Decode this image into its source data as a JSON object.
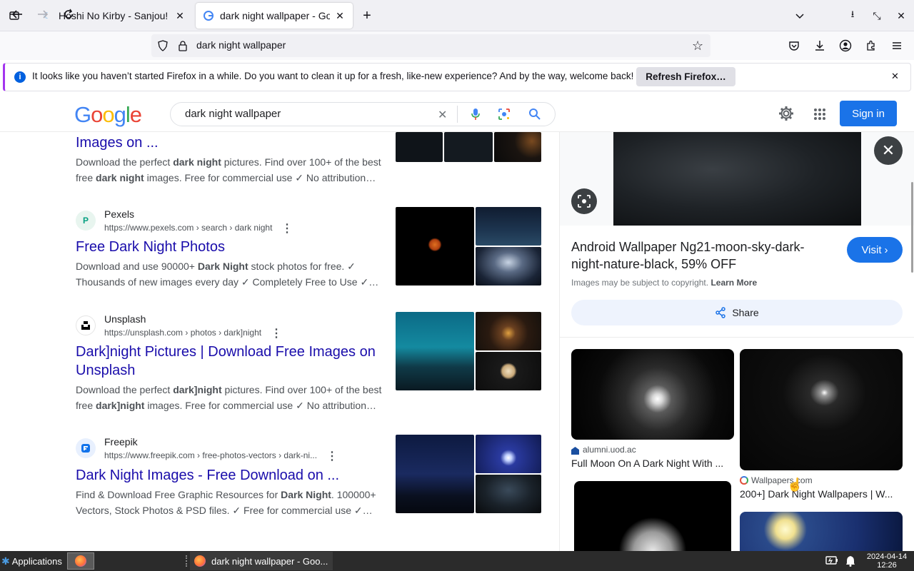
{
  "browser": {
    "tabs": [
      {
        "title": "Hoshi No Kirby - Sanjou! Do",
        "active": false
      },
      {
        "title": "dark night wallpaper - Goog",
        "active": true
      }
    ],
    "new_tab_symbol": "+",
    "address": "dark night wallpaper",
    "notification": {
      "message": "It looks like you haven’t started Firefox in a while. Do you want to clean it up for a fresh, like-new experience? And by the way, welcome back!",
      "button": "Refresh Firefox…"
    }
  },
  "google": {
    "logo": "Google",
    "query": "dark night wallpaper",
    "sign_in": "Sign in"
  },
  "results": [
    {
      "title": "Images on ...",
      "snippet_parts": [
        "Download the perfect ",
        "dark night",
        " pictures. Find over 100+ of the best free ",
        "dark night",
        " images. Free for commercial use ✓ No attribution…"
      ]
    },
    {
      "site": "Pexels",
      "url": "https://www.pexels.com › search › dark night",
      "title": "Free Dark Night Photos",
      "snippet_parts": [
        "Download and use 90000+ ",
        "Dark Night",
        " stock photos for free. ✓ Thousands of new images every day ✓ Completely Free to Use ✓…"
      ]
    },
    {
      "site": "Unsplash",
      "url": "https://unsplash.com › photos › dark]night",
      "title": "Dark]night Pictures | Download Free Images on Unsplash",
      "snippet_parts": [
        "Download the perfect ",
        "dark]night",
        " pictures. Find over 100+ of the best free ",
        "dark]night",
        " images. Free for commercial use ✓ No attribution…"
      ]
    },
    {
      "site": "Freepik",
      "url": "https://www.freepik.com › free-photos-vectors › dark-ni...",
      "title": "Dark Night Images - Free Download on ...",
      "snippet_parts": [
        "Find & Download Free Graphic Resources for ",
        "Dark Night",
        ". 100000+ Vectors, Stock Photos & PSD files. ✓ Free for commercial use ✓…"
      ]
    }
  ],
  "panel": {
    "title": "Android Wallpaper Ng21-moon-sky-dark-night-nature-black, 59% OFF",
    "visit": "Visit",
    "copyright": "Images may be subject to copyright.",
    "learn_more": "Learn More",
    "share": "Share",
    "related": [
      {
        "source": "alumni.uod.ac",
        "title": "Full Moon On A Dark Night With ..."
      },
      {
        "source": "Wallpapers.com",
        "title": "200+] Dark Night Wallpapers | W..."
      }
    ]
  },
  "taskbar": {
    "applications": "Applications",
    "window_title": "dark night wallpaper - Goo...",
    "date": "2024-04-14",
    "time": "12:26"
  },
  "colors": {
    "link": "#1a0dab",
    "accent": "#1a73e8",
    "notification_accent": "#a335ee"
  }
}
